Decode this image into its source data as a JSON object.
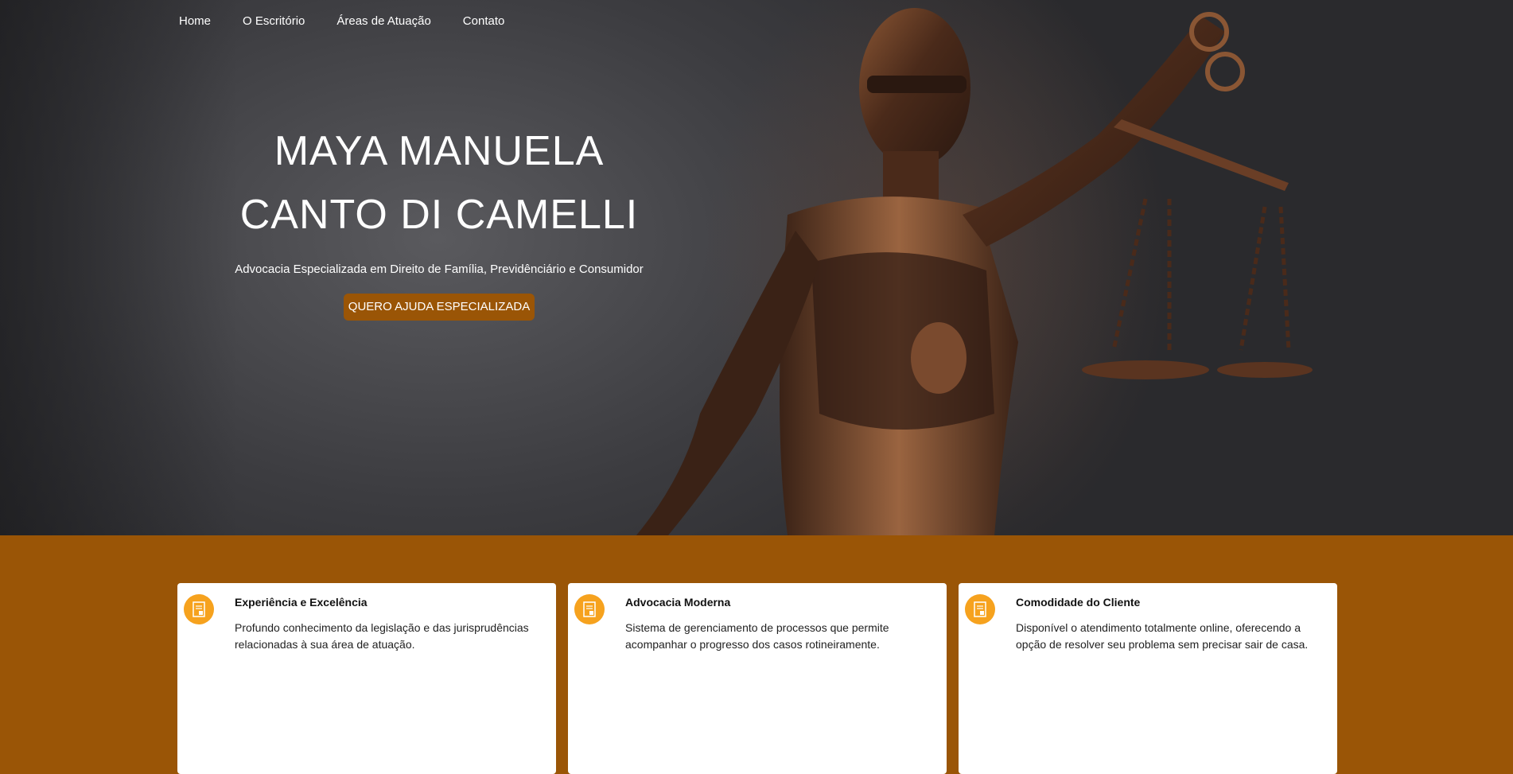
{
  "nav": {
    "items": [
      {
        "label": "Home"
      },
      {
        "label": "O Escritório"
      },
      {
        "label": "Áreas de Atuação"
      },
      {
        "label": "Contato"
      }
    ]
  },
  "hero": {
    "title_line1": "MAYA MANUELA",
    "title_line2": "CANTO DI CAMELLI",
    "subtitle": "Advocacia Especializada em Direito de Família, Previdênciário e Consumidor",
    "cta_label": "QUERO AJUDA ESPECIALIZADA",
    "background_image": "statue-of-justice-photo"
  },
  "features": [
    {
      "icon": "document-icon",
      "title": "Experiência e Excelência",
      "description": "Profundo conhecimento da legislação e das jurisprudências relacionadas à sua área de atuação."
    },
    {
      "icon": "document-icon",
      "title": "Advocacia Moderna",
      "description": "Sistema de gerenciamento de processos que permite acompanhar o progresso dos casos rotineiramente."
    },
    {
      "icon": "document-icon",
      "title": "Comodidade do Cliente",
      "description": "Disponível o atendimento totalmente online, oferecendo a opção de resolver seu problema sem precisar sair de casa."
    }
  ],
  "colors": {
    "accent": "#9a5506",
    "icon_badge": "#f6a21e",
    "hero_bg": "#3c3c40"
  }
}
